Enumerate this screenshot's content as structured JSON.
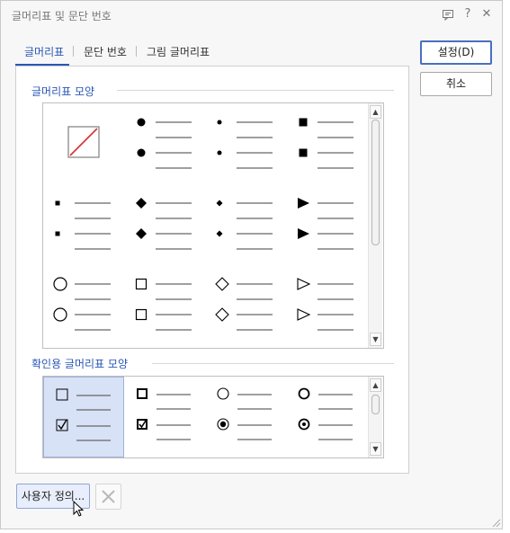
{
  "window": {
    "title": "글머리표 및 문단 번호"
  },
  "tabs": [
    {
      "label": "글머리표",
      "active": true
    },
    {
      "label": "문단 번호",
      "active": false
    },
    {
      "label": "그림 글머리표",
      "active": false
    }
  ],
  "buttons": {
    "ok": "설정(D)",
    "cancel": "취소",
    "user_defined": "사용자 정의..."
  },
  "sections": {
    "bullet_shapes": "글머리표 모양",
    "checkbox_shapes": "확인용 글머리표 모양"
  },
  "bullet_grid": {
    "items": [
      "none",
      "filled-circle",
      "small-dot",
      "filled-square",
      "small-square",
      "filled-diamond",
      "small-diamond",
      "filled-triangle",
      "hollow-circle",
      "hollow-square",
      "hollow-diamond",
      "hollow-triangle"
    ],
    "selected": null
  },
  "checkbox_grid": {
    "items": [
      "square-checkbox",
      "bold-square-checkbox",
      "radio-circle",
      "bold-radio-circle"
    ],
    "selected": 0
  },
  "icons": {
    "title_icons": [
      "chat-icon",
      "help-icon",
      "close-icon"
    ]
  }
}
